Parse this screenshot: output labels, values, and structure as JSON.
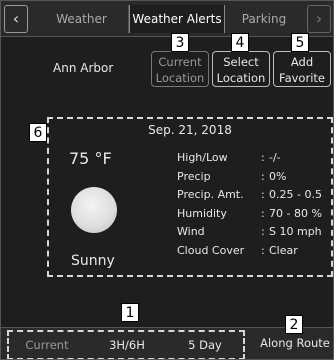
{
  "tabs": {
    "back_glyph": "‹",
    "forward_glyph": "›",
    "weather": "Weather",
    "alerts": "Weather Alerts",
    "parking": "Parking"
  },
  "location": "Ann Arbor",
  "actions": {
    "current_location": "Current Location",
    "select_location": "Select Location",
    "add_favorite": "Add Favorite"
  },
  "callouts": [
    "1",
    "2",
    "3",
    "4",
    "5",
    "6"
  ],
  "forecast": {
    "date": "Sep. 21, 2018",
    "temperature": "75 °F",
    "condition": "Sunny",
    "icon": "sun-icon",
    "details": [
      {
        "label": "High/Low",
        "value": "-/-"
      },
      {
        "label": "Precip",
        "value": "0%"
      },
      {
        "label": "Precip. Amt.",
        "value": "0.25 - 0.5"
      },
      {
        "label": "Humidity",
        "value": "70 - 80 %"
      },
      {
        "label": "Wind",
        "value": "S 10 mph"
      },
      {
        "label": "Cloud Cover",
        "value": "Clear"
      }
    ],
    "separator": ":"
  },
  "bottom": {
    "current": "Current",
    "hourly": "3H/6H",
    "five_day": "5 Day",
    "along_route": "Along Route"
  }
}
